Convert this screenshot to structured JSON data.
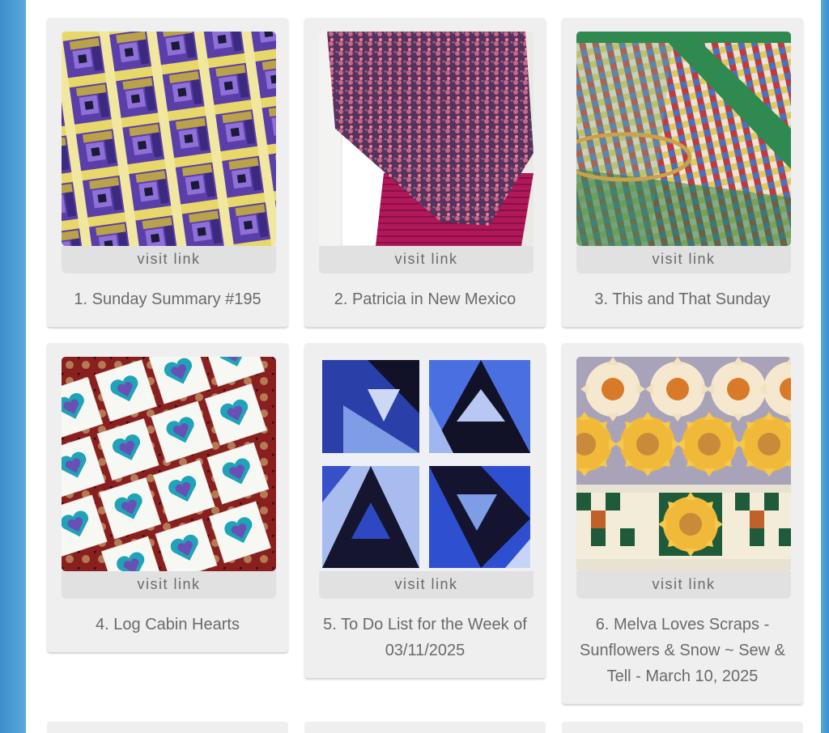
{
  "links": [
    {
      "number": "1.",
      "title": "Sunday Summary #195",
      "visit_label": "visit link",
      "image": "purple-yellow-log-cabin-quilt"
    },
    {
      "number": "2.",
      "title": "Patricia in New Mexico",
      "visit_label": "visit link",
      "image": "crocheted-shawl-pink"
    },
    {
      "number": "3.",
      "title": "This and That Sunday",
      "visit_label": "visit link",
      "image": "scrappy-green-quilt-with-hoop"
    },
    {
      "number": "4.",
      "title": "Log Cabin Hearts",
      "visit_label": "visit link",
      "image": "teal-heart-blocks-on-rug"
    },
    {
      "number": "5.",
      "title": "To Do List for the Week of 03/11/2025",
      "visit_label": "visit link",
      "image": "blue-flying-geese-blocks"
    },
    {
      "number": "6.",
      "title": "Melva Loves Scraps - Sunflowers & Snow ~ Sew & Tell - March 10, 2025",
      "visit_label": "visit link",
      "image": "sunflower-quilt-border"
    }
  ],
  "colors": {
    "frame_blue": "#4a9ad4",
    "card_bg": "#efefef",
    "visit_bg": "#e1e1e1",
    "text_gray": "#6a6a6a"
  }
}
